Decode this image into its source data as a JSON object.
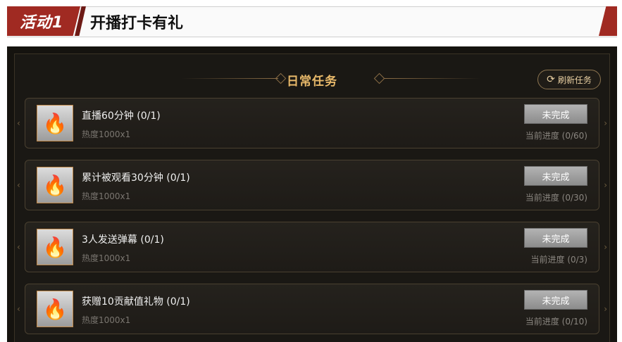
{
  "banner": {
    "tag": "活动1",
    "title": "开播打卡有礼"
  },
  "panel": {
    "title": "日常任务",
    "refresh_label": "刷新任务",
    "refresh_icon": "refresh-icon"
  },
  "tasks": [
    {
      "name": "直播60分钟 (0/1)",
      "reward": "热度1000x1",
      "status": "未完成",
      "progress": "当前进度 (0/60)"
    },
    {
      "name": "累计被观看30分钟 (0/1)",
      "reward": "热度1000x1",
      "status": "未完成",
      "progress": "当前进度 (0/30)"
    },
    {
      "name": "3人发送弹幕 (0/1)",
      "reward": "热度1000x1",
      "status": "未完成",
      "progress": "当前进度 (0/3)"
    },
    {
      "name": "获赠10贡献值礼物 (0/1)",
      "reward": "热度1000x1",
      "status": "未完成",
      "progress": "当前进度 (0/10)"
    }
  ],
  "colors": {
    "accent": "#a02a22",
    "gold": "#e8b96a",
    "panel_bg": "#15130f"
  }
}
